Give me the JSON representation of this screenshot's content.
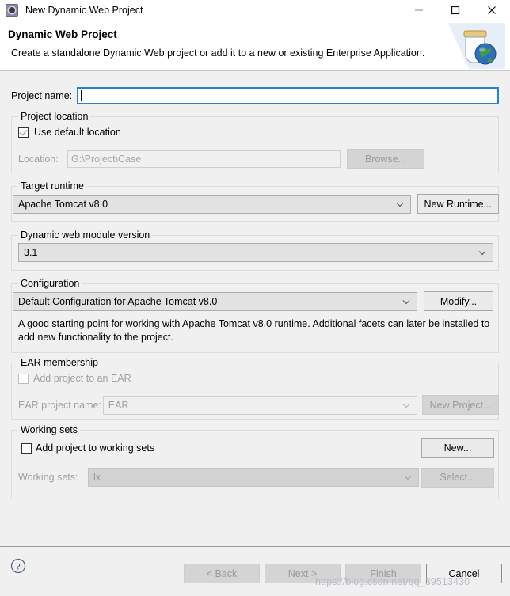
{
  "window": {
    "title": "New Dynamic Web Project",
    "icon": "eclipse-wizard-icon",
    "minimize_label": "—",
    "maximize_label": "□",
    "close_label": "✕"
  },
  "banner": {
    "title": "Dynamic Web Project",
    "description": "Create a standalone Dynamic Web project or add it to a new or existing Enterprise Application.",
    "image": "jar-with-globe-icon"
  },
  "project_name": {
    "label": "Project name:",
    "value": "",
    "placeholder": ""
  },
  "project_location": {
    "group_title": "Project location",
    "use_default_label": "Use default location",
    "use_default_checked": true,
    "location_label": "Location:",
    "location_value": "G:\\Project\\Case",
    "browse_label": "Browse..."
  },
  "target_runtime": {
    "group_title": "Target runtime",
    "value": "Apache Tomcat v8.0",
    "new_runtime_label": "New Runtime..."
  },
  "module_version": {
    "group_title": "Dynamic web module version",
    "value": "3.1"
  },
  "configuration": {
    "group_title": "Configuration",
    "value": "Default Configuration for Apache Tomcat v8.0",
    "modify_label": "Modify...",
    "description": "A good starting point for working with Apache Tomcat v8.0 runtime. Additional facets can later be installed to add new functionality to the project."
  },
  "ear_membership": {
    "group_title": "EAR membership",
    "add_to_ear_label": "Add project to an EAR",
    "add_to_ear_checked": false,
    "ear_project_label": "EAR project name:",
    "ear_project_value": "EAR",
    "new_project_label": "New Project..."
  },
  "working_sets": {
    "group_title": "Working sets",
    "add_to_working_sets_label": "Add project to working sets",
    "add_to_working_sets_checked": false,
    "new_label": "New...",
    "working_sets_label": "Working sets:",
    "working_sets_value": "lx",
    "select_label": "Select..."
  },
  "footer": {
    "help_icon": "help-question-icon",
    "back_label": "< Back",
    "next_label": "Next >",
    "finish_label": "Finish",
    "cancel_label": "Cancel"
  },
  "watermark": {
    "text": "https://blog.csdn.net/qq_39513430"
  },
  "colors": {
    "dialog_bg": "#f0f0f0",
    "focus_blue": "#2b7fd4",
    "disabled_text": "#a0a0a0",
    "combo_bg": "#e2e2e2"
  }
}
